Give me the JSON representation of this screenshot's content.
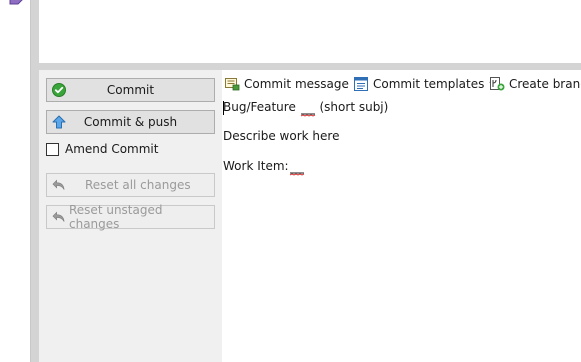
{
  "commit_panel": {
    "commit_label": "Commit",
    "commit_push_label": "Commit & push",
    "amend_label": "Amend Commit",
    "amend_checked": false,
    "reset_all_label": "Reset all changes",
    "reset_unstaged_label": "Reset unstaged changes"
  },
  "toolbar": {
    "commit_message_label": "Commit message",
    "commit_templates_label": "Commit templates",
    "create_branch_label": "Create branch"
  },
  "message": {
    "line1_prefix": "Bug/Feature",
    "line1_suffix": "(short subj)",
    "line2": "Describe work here",
    "line3": "Work Item:"
  },
  "colors": {
    "accent_green": "#3aa53a",
    "accent_blue": "#3f8fd8",
    "spell_red": "#d21a1a",
    "disabled_text": "#9a9a9a"
  },
  "icons": [
    "tag-icon",
    "checkmark-icon",
    "up-arrow-icon",
    "undo-icon",
    "message-icon",
    "template-icon",
    "branch-icon"
  ]
}
